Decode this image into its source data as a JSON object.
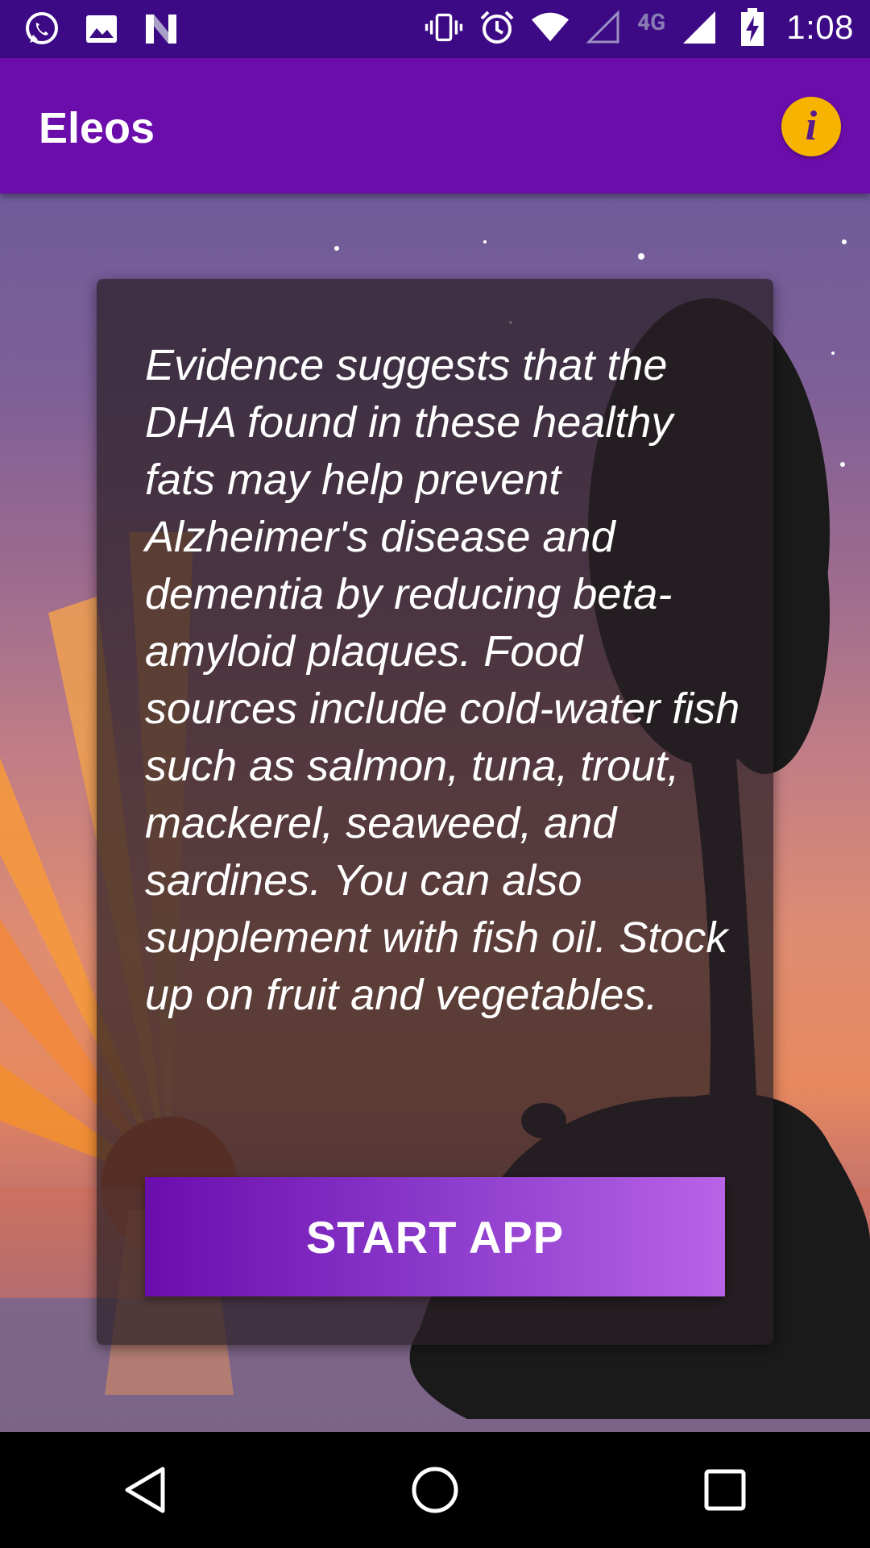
{
  "status_bar": {
    "time": "1:08",
    "network_label": "4G",
    "left_icons": [
      "whatsapp-icon",
      "image-icon",
      "n-icon"
    ],
    "right_icons": [
      "vibrate-icon",
      "alarm-icon",
      "wifi-icon",
      "signal-empty-icon",
      "signal-full-icon",
      "battery-charging-icon"
    ]
  },
  "app_bar": {
    "title": "Eleos",
    "info_icon": "info-icon",
    "info_symbol": "i"
  },
  "card": {
    "text": "Evidence suggests that the DHA found in these healthy fats may help prevent Alzheimer's disease and dementia by reducing beta-amyloid plaques. Food sources include cold-water fish such as salmon, tuna, trout, mackerel, seaweed, and sardines. You can also supplement with fish oil. Stock up on fruit and vegetables.",
    "button_label": "START APP"
  },
  "nav_bar": {
    "items": [
      "back-icon",
      "home-icon",
      "recents-icon"
    ]
  },
  "colors": {
    "status_bar": "#3c0a85",
    "app_bar": "#6a0dab",
    "info_button": "#f6b400",
    "button_start": "#6a0dad",
    "button_end": "#b863e6"
  }
}
